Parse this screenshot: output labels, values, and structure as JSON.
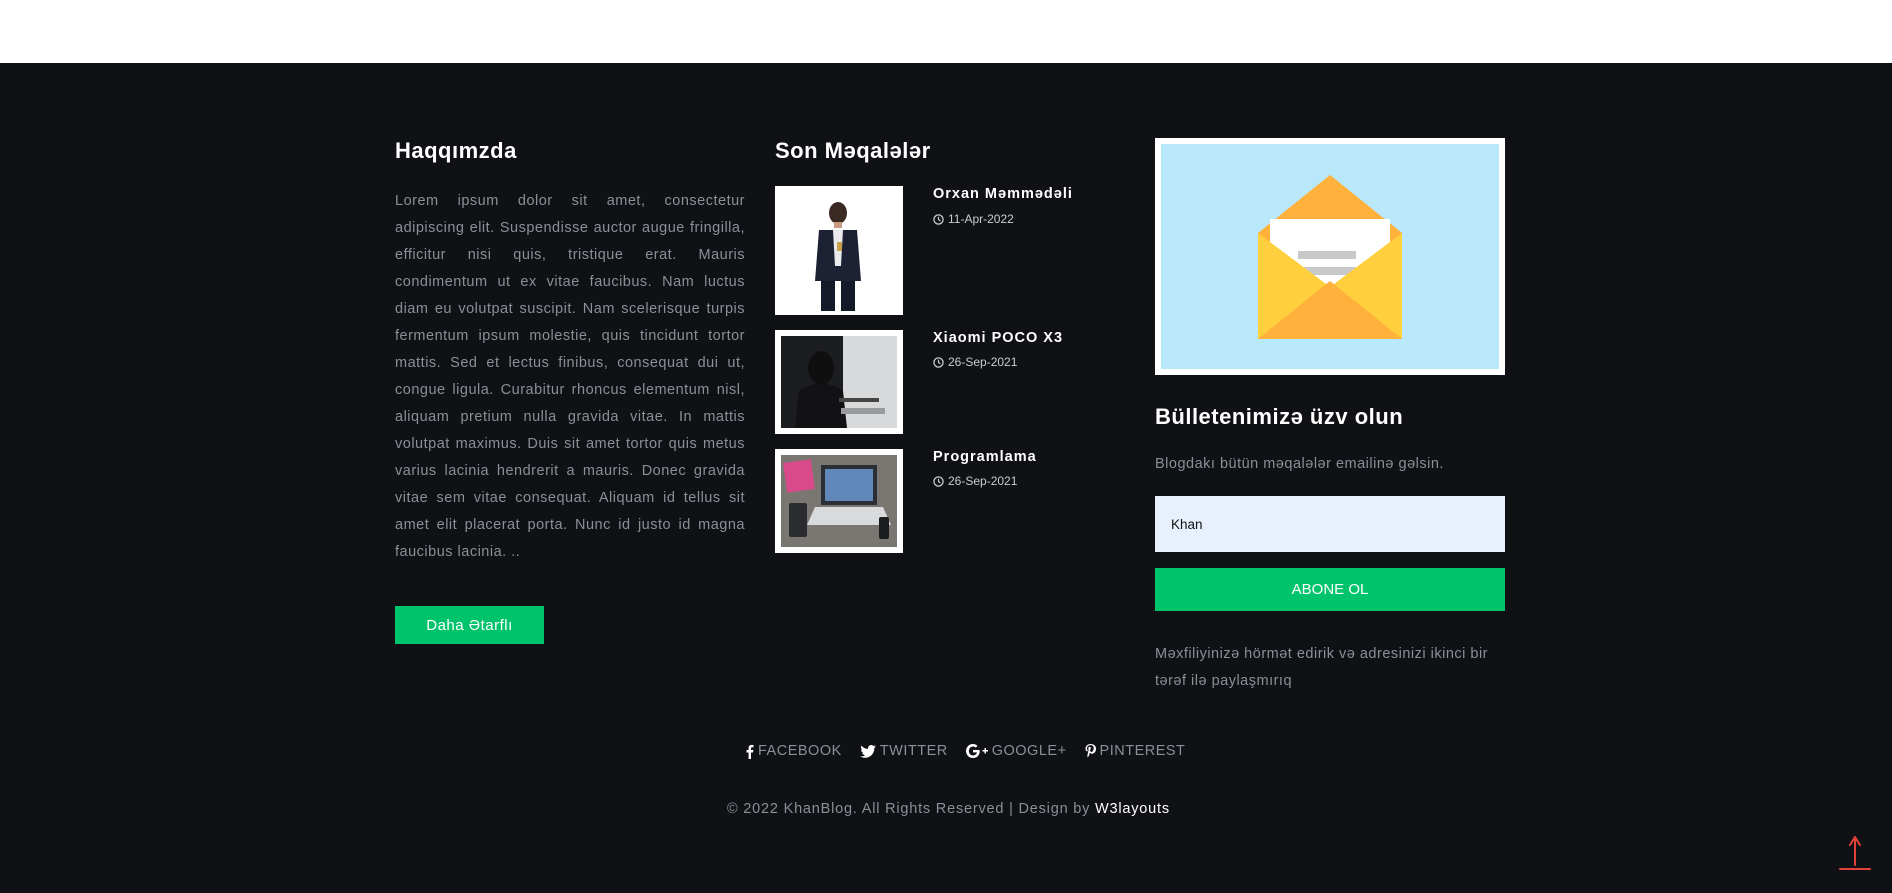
{
  "about": {
    "title": "Haqqımzda",
    "text": "Lorem ipsum dolor sit amet, consectetur adipiscing elit. Suspendisse auctor augue fringilla, efficitur nisi quis, tristique erat. Mauris condimentum ut ex vitae faucibus. Nam luctus diam eu volutpat suscipit. Nam scelerisque turpis fermentum ipsum molestie, quis tincidunt tortor mattis. Sed et lectus finibus, consequat dui ut, congue ligula. Curabitur rhoncus elementum nisl, aliquam pretium nulla gravida vitae. In mattis volutpat maximus. Duis sit amet tortor quis metus varius lacinia hendrerit a mauris. Donec gravida vitae sem vitae consequat. Aliquam id tellus sit amet elit placerat porta. Nunc id justo id magna faucibus lacinia. ..",
    "button_label": "Daha Ətarflı"
  },
  "recent": {
    "title": "Son Məqalələr",
    "posts": [
      {
        "title": "Orxan Məmmədəli",
        "date": "11-Apr-2022",
        "icon": "clock-icon"
      },
      {
        "title": "Xiaomi POCO X3",
        "date": "26-Sep-2021",
        "icon": "clock-icon"
      },
      {
        "title": "Programlama",
        "date": "26-Sep-2021",
        "icon": "clock-icon"
      }
    ]
  },
  "newsletter": {
    "title": "Bülletenimizə üzv olun",
    "description": "Blogdakı bütün məqalələr emailinə gəlsin.",
    "input_value": "Khan",
    "button_label": "ABONE OL",
    "privacy": "Məxfiliyinizə hörmət edirik və adresinizi ikinci bir tərəf ilə paylaşmırıq"
  },
  "social": [
    {
      "label": "FACEBOOK",
      "icon": "facebook-icon"
    },
    {
      "label": "TWITTER",
      "icon": "twitter-icon"
    },
    {
      "label": "GOOGLE+",
      "icon": "google-plus-icon"
    },
    {
      "label": "PINTEREST",
      "icon": "pinterest-icon"
    }
  ],
  "copyright": {
    "text": "© 2022 KhanBlog. All Rights Reserved | Design by ",
    "link": "W3layouts"
  },
  "colors": {
    "footer_bg": "#0f1115",
    "accent": "#00c46b",
    "to_top_arrow": "#e2413a"
  }
}
